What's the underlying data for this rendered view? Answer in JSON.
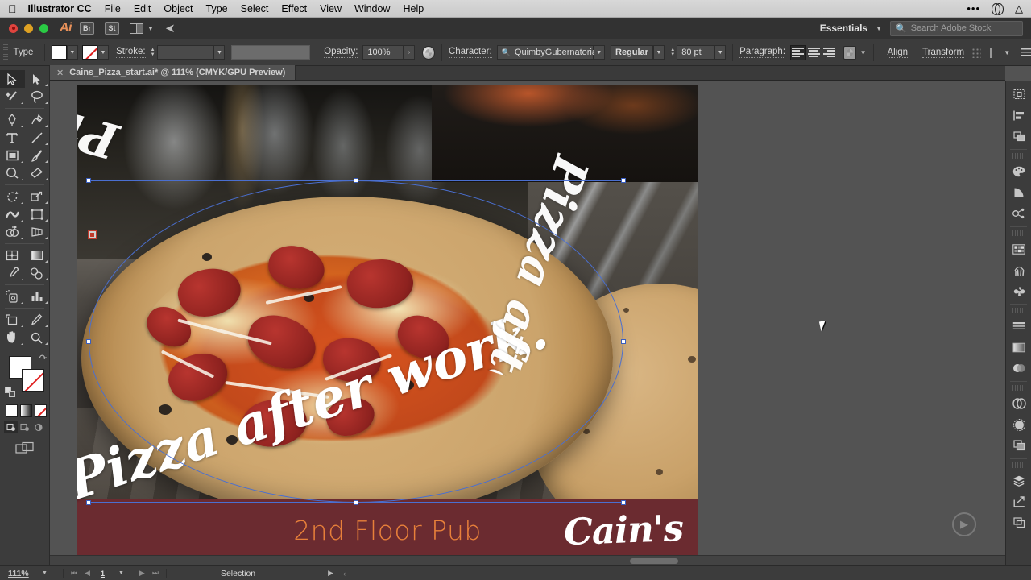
{
  "menubar": {
    "apple_icon": "apple-icon",
    "app_name": "Illustrator CC",
    "items": [
      "File",
      "Edit",
      "Object",
      "Type",
      "Select",
      "Effect",
      "View",
      "Window",
      "Help"
    ],
    "status_icons": [
      "ellipsis-icon",
      "creative-cloud-icon",
      "wifi-icon"
    ]
  },
  "appbar": {
    "bridge_label": "Br",
    "stock_label": "St",
    "arrange_icon": "arrange-documents-icon",
    "share_icon": "share-plane-icon",
    "workspace": "Essentials",
    "search_placeholder": "Search Adobe Stock",
    "search_icon": "search-icon"
  },
  "control_bar": {
    "object_type": "Type",
    "fill_swatch": "#FFFFFF",
    "stroke_label": "Stroke:",
    "stroke_weight": "",
    "opacity_label": "Opacity:",
    "opacity_value": "100%",
    "opacity_arrow": "›",
    "transparency_icon": "opacity-mask-icon",
    "character_label": "Character:",
    "font_family": "QuimbyGubernatorial",
    "font_style": "Regular",
    "font_size": "80 pt",
    "paragraph_label": "Paragraph:",
    "align_left_icon": "align-left-icon",
    "align_center_icon": "align-center-icon",
    "align_right_icon": "align-right-icon",
    "wrap_icon": "text-wrap-icon",
    "align_label": "Align",
    "transform_label": "Transform",
    "distribute_icon": "distribute-icon",
    "arrange_icon": "arrange-icon",
    "options_icon": "panel-options-icon"
  },
  "document_tab": {
    "close_icon": "close-icon",
    "title": "Cains_Pizza_start.ai* @ 111% (CMYK/GPU Preview)"
  },
  "tools": [
    {
      "name": "selection-tool",
      "glyph": "selection",
      "selected": true
    },
    {
      "name": "direct-selection-tool",
      "glyph": "direct-selection",
      "selected": false
    },
    {
      "name": "magic-wand-tool",
      "glyph": "magic-wand",
      "selected": false
    },
    {
      "name": "lasso-tool",
      "glyph": "lasso",
      "selected": false
    },
    {
      "name": "pen-tool",
      "glyph": "pen",
      "selected": false
    },
    {
      "name": "curvature-tool",
      "glyph": "curvature",
      "selected": false
    },
    {
      "name": "type-tool",
      "glyph": "type",
      "selected": false
    },
    {
      "name": "line-segment-tool",
      "glyph": "line",
      "selected": false
    },
    {
      "name": "rectangle-tool",
      "glyph": "rectangle",
      "selected": false
    },
    {
      "name": "paintbrush-tool",
      "glyph": "paintbrush",
      "selected": false
    },
    {
      "name": "shaper-tool",
      "glyph": "shaper",
      "selected": false
    },
    {
      "name": "eraser-tool",
      "glyph": "eraser",
      "selected": false
    },
    {
      "name": "rotate-tool",
      "glyph": "rotate",
      "selected": false
    },
    {
      "name": "scale-tool",
      "glyph": "scale",
      "selected": false
    },
    {
      "name": "width-tool",
      "glyph": "width",
      "selected": false
    },
    {
      "name": "free-transform-tool",
      "glyph": "free-transform",
      "selected": false
    },
    {
      "name": "shape-builder-tool",
      "glyph": "shape-builder",
      "selected": false
    },
    {
      "name": "perspective-grid-tool",
      "glyph": "perspective-grid",
      "selected": false
    },
    {
      "name": "mesh-tool",
      "glyph": "mesh",
      "selected": false
    },
    {
      "name": "gradient-tool",
      "glyph": "gradient",
      "selected": false
    },
    {
      "name": "eyedropper-tool",
      "glyph": "eyedropper",
      "selected": false
    },
    {
      "name": "blend-tool",
      "glyph": "blend",
      "selected": false
    },
    {
      "name": "symbol-sprayer-tool",
      "glyph": "symbol-sprayer",
      "selected": false
    },
    {
      "name": "column-graph-tool",
      "glyph": "column-graph",
      "selected": false
    },
    {
      "name": "artboard-tool",
      "glyph": "artboard",
      "selected": false
    },
    {
      "name": "slice-tool",
      "glyph": "slice",
      "selected": false
    },
    {
      "name": "hand-tool",
      "glyph": "hand",
      "selected": false
    },
    {
      "name": "zoom-tool",
      "glyph": "zoom",
      "selected": false
    }
  ],
  "tool_colors": {
    "fill": "#FFFFFF",
    "stroke": "#FFFFFF",
    "stroke_none": true,
    "swap_icon": "swap-fill-stroke-icon",
    "default_icon": "default-fill-stroke-icon",
    "modes": [
      "color-mode",
      "gradient-mode",
      "none-mode"
    ],
    "draw_modes": [
      "draw-normal",
      "draw-behind",
      "draw-inside"
    ],
    "screen_mode_icon": "change-screen-mode-icon"
  },
  "dock_icons": [
    "artboards-panel-icon",
    "align-panel-icon",
    "pathfinder-panel-icon",
    "color-panel-icon",
    "color-guide-panel-icon",
    "recolor-artwork-icon",
    "swatches-panel-icon",
    "brushes-panel-icon",
    "symbols-panel-icon",
    "stroke-panel-icon",
    "gradient-panel-icon",
    "transparency-panel-icon",
    "cc-libraries-panel-icon",
    "appearance-panel-icon",
    "graphic-styles-panel-icon",
    "layers-panel-icon",
    "artboard-export-icon",
    "asset-export-icon"
  ],
  "artwork": {
    "headline": "Pizza after work.",
    "headline_repeat": "Pizza after work.",
    "banner_text": "2nd Floor Pub",
    "logo_text": "Cain's",
    "banner_color": "#6B2B30",
    "banner_text_color": "#E8803A",
    "headline_color": "#FFFFFF"
  },
  "status_bar": {
    "zoom": "111%",
    "zoom_dropdown_icon": "chevron-down-icon",
    "first_page_icon": "first-page-icon",
    "prev_page_icon": "prev-page-icon",
    "page": "1",
    "next_page_icon": "next-page-icon",
    "last_page_icon": "last-page-icon",
    "page_dropdown_icon": "chevron-down-icon",
    "status": "Selection",
    "status_menu_icon": "status-menu-icon",
    "resize_icon": "resize-grip-icon"
  }
}
